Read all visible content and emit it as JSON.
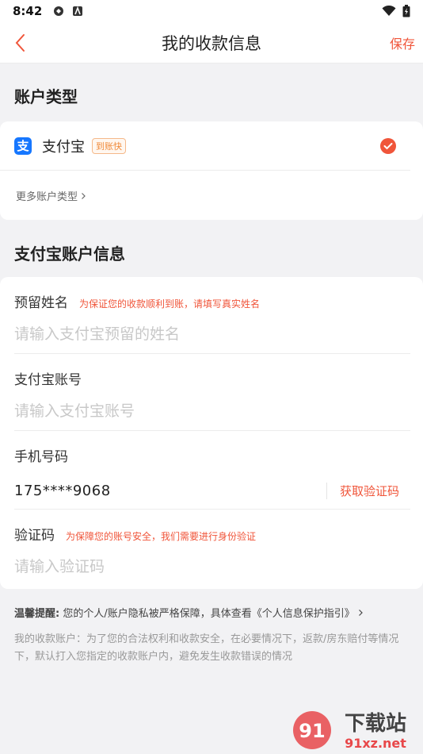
{
  "status_bar": {
    "time": "8:42"
  },
  "nav": {
    "title": "我的收款信息",
    "save_label": "保存"
  },
  "account_type": {
    "heading": "账户类型",
    "selected": {
      "name": "支付宝",
      "logo_char": "支",
      "badge": "到账快"
    },
    "more_label": "更多账户类型"
  },
  "account_info": {
    "heading": "支付宝账户信息",
    "fields": [
      {
        "label": "预留姓名",
        "hint": "为保证您的收款顺利到账，请填写真实姓名",
        "placeholder": "请输入支付宝预留的姓名",
        "value": ""
      },
      {
        "label": "支付宝账号",
        "hint": "",
        "placeholder": "请输入支付宝账号",
        "value": ""
      },
      {
        "label": "手机号码",
        "hint": "",
        "value": "175****9068",
        "action": "获取验证码"
      },
      {
        "label": "验证码",
        "hint": "为保障您的账号安全，我们需要进行身份验证",
        "placeholder": "请输入验证码",
        "value": ""
      }
    ]
  },
  "tips": {
    "reminder_prefix": "温馨提醒:",
    "reminder_text": "您的个人/账户隐私被严格保障，具体查看《个人信息保护指引》",
    "note": "我的收款账户：为了您的合法权利和收款安全，在必要情况下，返款/房东赔付等情况下，默认打入您指定的收款账户内，避免发生收款错误的情况"
  },
  "watermark": {
    "title": "下载站",
    "domain": "91xz.net"
  },
  "colors": {
    "accent": "#f0553a",
    "alipay_blue": "#1677ff",
    "background": "#f2f2f4"
  },
  "icons": [
    "back-arrow-icon",
    "alipay-logo-icon",
    "checkmark-icon",
    "chevron-right-icon",
    "wifi-icon",
    "battery-icon"
  ]
}
